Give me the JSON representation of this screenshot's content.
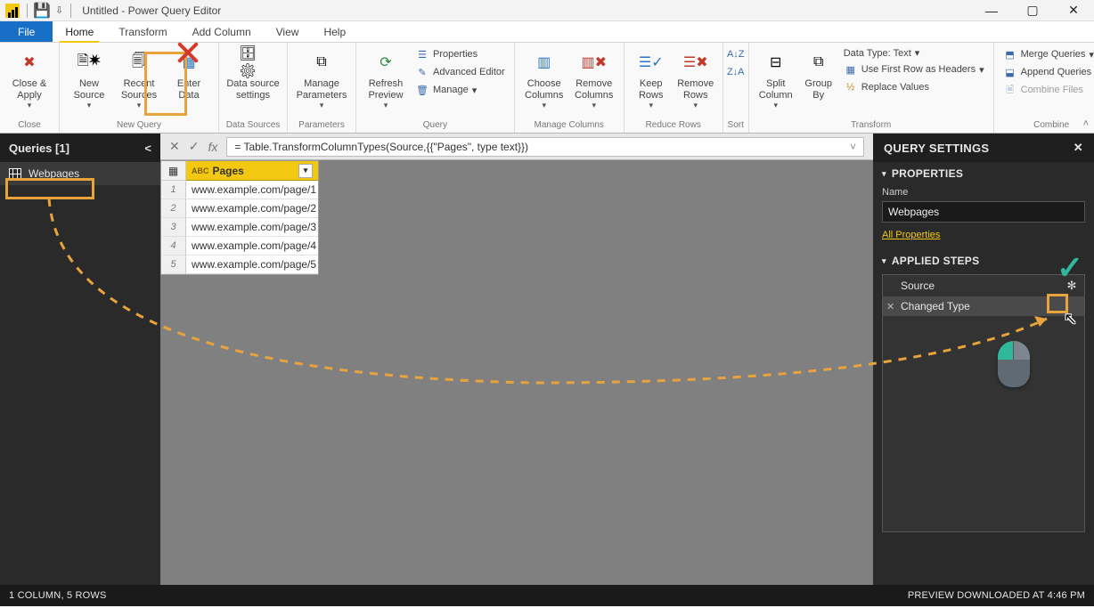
{
  "titlebar": {
    "title": "Untitled - Power Query Editor"
  },
  "win": {
    "min": "—",
    "max": "▢",
    "close": "✕"
  },
  "tabs": {
    "file": "File",
    "home": "Home",
    "transform": "Transform",
    "add": "Add Column",
    "view": "View",
    "help": "Help"
  },
  "ribbon": {
    "close": {
      "label": "Close &\nApply",
      "group": "Close"
    },
    "newquery": {
      "new": "New\nSource",
      "recent": "Recent\nSources",
      "enter": "Enter\nData",
      "group": "New Query"
    },
    "ds": {
      "label": "Data source\nsettings",
      "group": "Data Sources"
    },
    "param": {
      "label": "Manage\nParameters",
      "group": "Parameters"
    },
    "query": {
      "refresh": "Refresh\nPreview",
      "props": "Properties",
      "adv": "Advanced Editor",
      "manage": "Manage",
      "group": "Query"
    },
    "cols": {
      "choose": "Choose\nColumns",
      "remove": "Remove\nColumns",
      "group": "Manage Columns"
    },
    "rows": {
      "keep": "Keep\nRows",
      "remove": "Remove\nRows",
      "group": "Reduce Rows"
    },
    "sort": {
      "group": "Sort"
    },
    "transform": {
      "split": "Split\nColumn",
      "group": "Group\nBy",
      "dtype": "Data Type: Text",
      "first": "Use First Row as Headers",
      "replace": "Replace Values",
      "gl": "Transform"
    },
    "combine": {
      "merge": "Merge Queries",
      "append": "Append Queries",
      "files": "Combine Files",
      "group": "Combine"
    }
  },
  "queries": {
    "title": "Queries [1]",
    "item": "Webpages"
  },
  "formula": "= Table.TransformColumnTypes(Source,{{\"Pages\", type text}})",
  "grid": {
    "col": "Pages",
    "type": "ABC",
    "rows": [
      "www.example.com/page/1",
      "www.example.com/page/2",
      "www.example.com/page/3",
      "www.example.com/page/4",
      "www.example.com/page/5"
    ]
  },
  "qs": {
    "title": "QUERY SETTINGS",
    "props": "PROPERTIES",
    "name_label": "Name",
    "name": "Webpages",
    "all": "All Properties",
    "steps": "APPLIED STEPS",
    "step1": "Source",
    "step2": "Changed Type"
  },
  "status": {
    "left": "1 COLUMN, 5 ROWS",
    "right": "PREVIEW DOWNLOADED AT 4:46 PM"
  }
}
